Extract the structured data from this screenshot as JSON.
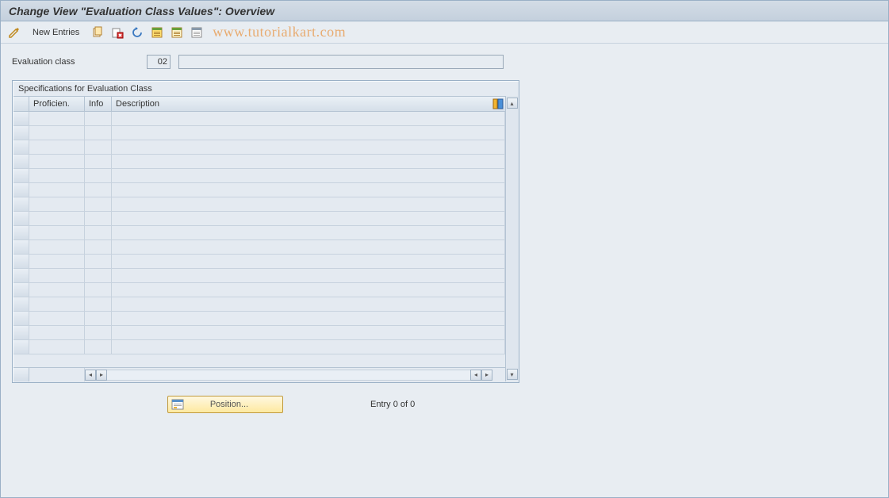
{
  "header": {
    "title": "Change View \"Evaluation Class Values\": Overview"
  },
  "toolbar": {
    "new_entries_label": "New Entries"
  },
  "watermark": "www.tutorialkart.com",
  "field": {
    "label": "Evaluation class",
    "code": "02",
    "description": ""
  },
  "group": {
    "title": "Specifications for Evaluation Class",
    "columns": {
      "proficiency": "Proficien.",
      "info": "Info",
      "description": "Description"
    },
    "rows": [
      {
        "proficiency": "",
        "info": "",
        "description": ""
      },
      {
        "proficiency": "",
        "info": "",
        "description": ""
      },
      {
        "proficiency": "",
        "info": "",
        "description": ""
      },
      {
        "proficiency": "",
        "info": "",
        "description": ""
      },
      {
        "proficiency": "",
        "info": "",
        "description": ""
      },
      {
        "proficiency": "",
        "info": "",
        "description": ""
      },
      {
        "proficiency": "",
        "info": "",
        "description": ""
      },
      {
        "proficiency": "",
        "info": "",
        "description": ""
      },
      {
        "proficiency": "",
        "info": "",
        "description": ""
      },
      {
        "proficiency": "",
        "info": "",
        "description": ""
      },
      {
        "proficiency": "",
        "info": "",
        "description": ""
      },
      {
        "proficiency": "",
        "info": "",
        "description": ""
      },
      {
        "proficiency": "",
        "info": "",
        "description": ""
      },
      {
        "proficiency": "",
        "info": "",
        "description": ""
      },
      {
        "proficiency": "",
        "info": "",
        "description": ""
      },
      {
        "proficiency": "",
        "info": "",
        "description": ""
      },
      {
        "proficiency": "",
        "info": "",
        "description": ""
      }
    ]
  },
  "footer": {
    "position_label": "Position...",
    "entry_status": "Entry 0 of 0"
  }
}
